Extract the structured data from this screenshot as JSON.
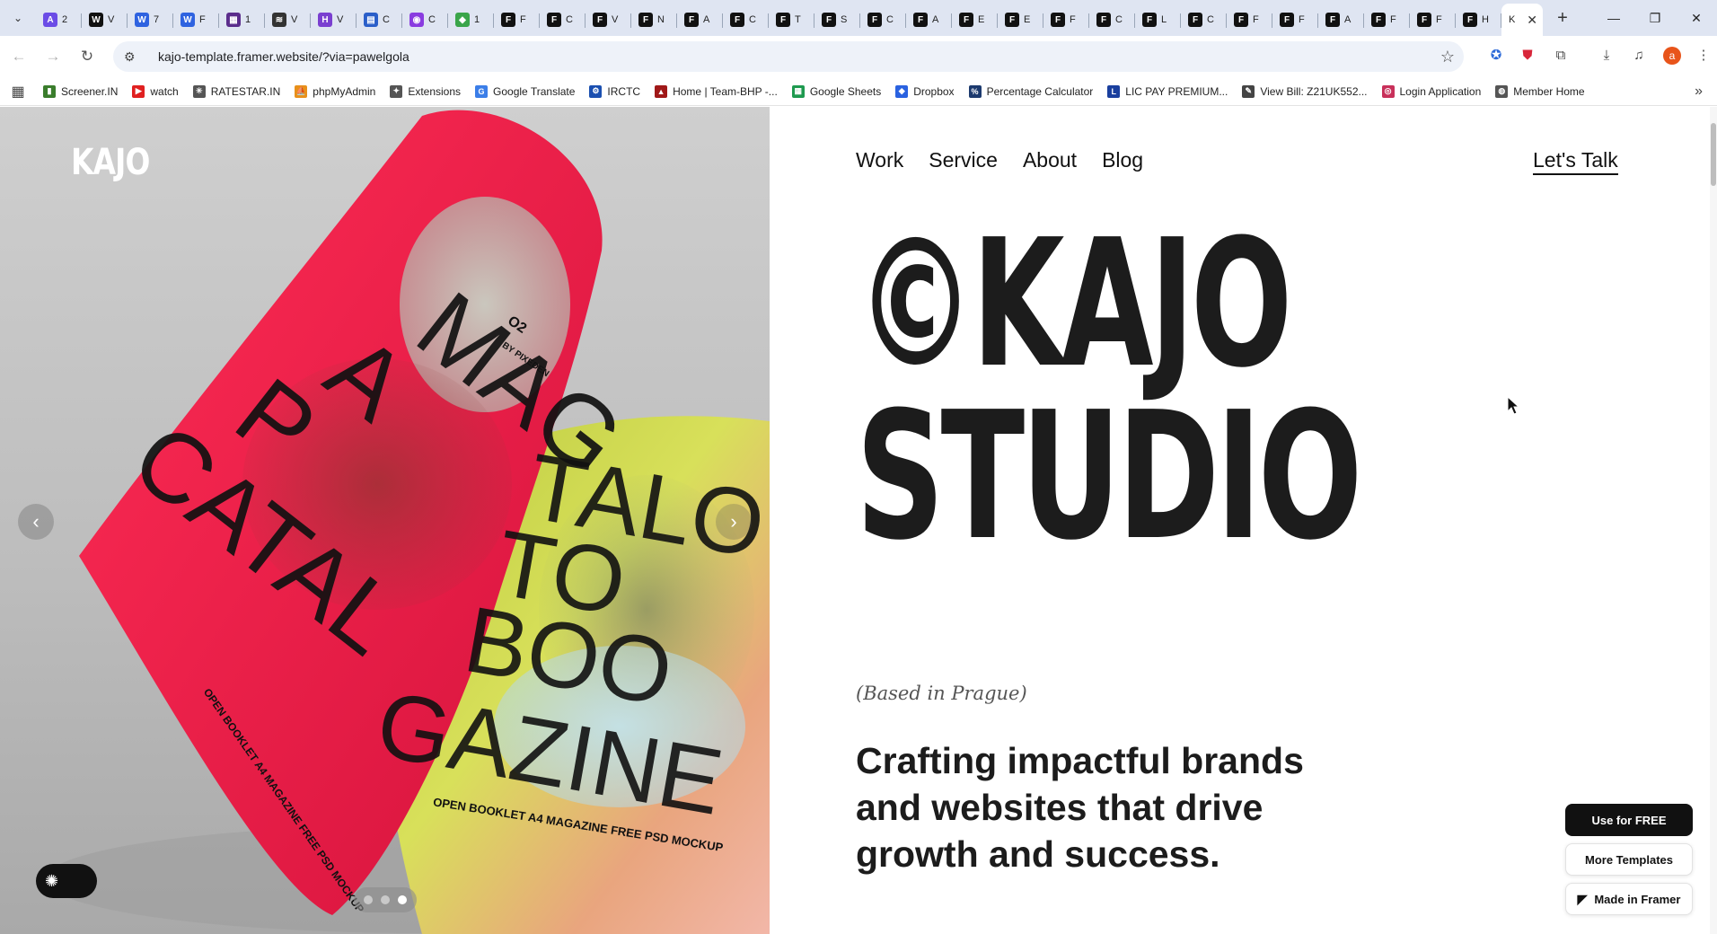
{
  "browser": {
    "tabs": [
      {
        "icon": "tab-icon-a",
        "title": "2",
        "color": "#6b4ce6",
        "glyph": "A"
      },
      {
        "icon": "tab-icon-wix",
        "title": "V",
        "color": "#111111",
        "glyph": "W"
      },
      {
        "icon": "tab-icon-w1",
        "title": "7",
        "color": "#2f63e0",
        "glyph": "W"
      },
      {
        "icon": "tab-icon-w2",
        "title": "F",
        "color": "#2f63e0",
        "glyph": "W"
      },
      {
        "icon": "tab-icon-template",
        "title": "1",
        "color": "#5b2d8c",
        "glyph": "▦"
      },
      {
        "icon": "tab-icon-stripes",
        "title": "V",
        "color": "#333333",
        "glyph": "≋"
      },
      {
        "icon": "tab-icon-h",
        "title": "V",
        "color": "#7a3fd0",
        "glyph": "H"
      },
      {
        "icon": "tab-icon-grid",
        "title": "C",
        "color": "#2b5fc9",
        "glyph": "▤"
      },
      {
        "icon": "tab-icon-circle",
        "title": "C",
        "color": "#8a3ce0",
        "glyph": "◉"
      },
      {
        "icon": "tab-icon-leaf",
        "title": "1",
        "color": "#3aa54a",
        "glyph": "◆"
      },
      {
        "icon": "framer-icon",
        "title": "F",
        "color": "#111111",
        "glyph": "F"
      },
      {
        "icon": "framer-icon",
        "title": "C",
        "color": "#111111",
        "glyph": "F"
      },
      {
        "icon": "framer-icon",
        "title": "V",
        "color": "#111111",
        "glyph": "F"
      },
      {
        "icon": "framer-icon",
        "title": "N",
        "color": "#111111",
        "glyph": "F"
      },
      {
        "icon": "framer-icon",
        "title": "A",
        "color": "#111111",
        "glyph": "F"
      },
      {
        "icon": "framer-icon",
        "title": "C",
        "color": "#111111",
        "glyph": "F"
      },
      {
        "icon": "framer-icon",
        "title": "T",
        "color": "#111111",
        "glyph": "F"
      },
      {
        "icon": "framer-icon",
        "title": "S",
        "color": "#111111",
        "glyph": "F"
      },
      {
        "icon": "framer-icon",
        "title": "C",
        "color": "#111111",
        "glyph": "F"
      },
      {
        "icon": "framer-icon",
        "title": "A",
        "color": "#111111",
        "glyph": "F"
      },
      {
        "icon": "framer-icon",
        "title": "E",
        "color": "#111111",
        "glyph": "F"
      },
      {
        "icon": "framer-icon",
        "title": "E",
        "color": "#111111",
        "glyph": "F"
      },
      {
        "icon": "framer-icon",
        "title": "F",
        "color": "#111111",
        "glyph": "F"
      },
      {
        "icon": "framer-icon",
        "title": "C",
        "color": "#111111",
        "glyph": "F"
      },
      {
        "icon": "framer-icon",
        "title": "L",
        "color": "#111111",
        "glyph": "F"
      },
      {
        "icon": "framer-icon",
        "title": "C",
        "color": "#111111",
        "glyph": "F"
      },
      {
        "icon": "framer-icon",
        "title": "F",
        "color": "#111111",
        "glyph": "F"
      },
      {
        "icon": "framer-icon",
        "title": "F",
        "color": "#111111",
        "glyph": "F"
      },
      {
        "icon": "framer-icon",
        "title": "A",
        "color": "#111111",
        "glyph": "F"
      },
      {
        "icon": "framer-icon",
        "title": "F",
        "color": "#111111",
        "glyph": "F"
      },
      {
        "icon": "framer-icon",
        "title": "F",
        "color": "#111111",
        "glyph": "F"
      },
      {
        "icon": "framer-icon",
        "title": "H",
        "color": "#111111",
        "glyph": "F"
      }
    ],
    "active_tab_title": "K",
    "url": "kajo-template.framer.website/?via=pawelgola",
    "profile_initial": "a",
    "bookmarks": [
      {
        "label": "Screener.IN",
        "color": "#3a7d2c",
        "glyph": "▮"
      },
      {
        "label": "watch",
        "color": "#e02020",
        "glyph": "▶"
      },
      {
        "label": "RATESTAR.IN",
        "color": "#555555",
        "glyph": "✳"
      },
      {
        "label": "phpMyAdmin",
        "color": "#e8901a",
        "glyph": "⛵"
      },
      {
        "label": "Extensions",
        "color": "#555555",
        "glyph": "✦"
      },
      {
        "label": "Google Translate",
        "color": "#3b7ee8",
        "glyph": "G"
      },
      {
        "label": "IRCTC",
        "color": "#1a4fb0",
        "glyph": "⚙"
      },
      {
        "label": "Home | Team-BHP -...",
        "color": "#a01818",
        "glyph": "▲"
      },
      {
        "label": "Google Sheets",
        "color": "#1e9a4f",
        "glyph": "▦"
      },
      {
        "label": "Dropbox",
        "color": "#2a62e0",
        "glyph": "◆"
      },
      {
        "label": "Percentage Calculator",
        "color": "#1c3a6e",
        "glyph": "%"
      },
      {
        "label": "LIC PAY PREMIUM...",
        "color": "#1a3f9e",
        "glyph": "L"
      },
      {
        "label": "View Bill: Z21UK552...",
        "color": "#444444",
        "glyph": "✎"
      },
      {
        "label": "Login Application",
        "color": "#c8305a",
        "glyph": "◎"
      },
      {
        "label": "Member Home",
        "color": "#555555",
        "glyph": "◍"
      }
    ]
  },
  "site": {
    "logo": "KAJO",
    "nav": [
      "Work",
      "Service",
      "About",
      "Blog"
    ],
    "cta": "Let's Talk",
    "headline_line1": "©KAJO",
    "headline_line2": "STUDIO",
    "based": "(Based in Prague)",
    "tagline": "Crafting impactful brands and websites that drive growth and success.",
    "slider": {
      "count": 3,
      "active": 3
    },
    "image_text": {
      "issue": "O2",
      "byline": "BY PIXEDEN",
      "left_words": [
        "MAG",
        "A",
        "P",
        "CATAL"
      ],
      "right_words": [
        "TALO",
        "TO",
        "BOO",
        "GAZINE"
      ],
      "caption": "OPEN BOOKLET A4 MAGAZINE FREE PSD MOCKUP"
    }
  },
  "framer": {
    "use_free": "Use for FREE",
    "more_templates": "More Templates",
    "made_in": "Made in Framer"
  },
  "colors": {
    "text": "#1c1c1c",
    "accent_pink": "#e8214f",
    "accent_yellow": "#c8d43a"
  }
}
